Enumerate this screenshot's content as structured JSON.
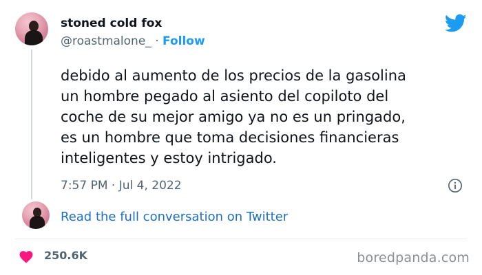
{
  "author": {
    "display_name": "stoned cold fox",
    "handle": "@roastmalone_",
    "separator": "·",
    "follow_label": "Follow"
  },
  "tweet": {
    "lines": [
      "debido al aumento de los precios de la gasolina",
      "un hombre pegado al asiento del copiloto del",
      "coche de su mejor amigo ya no es un pringado,",
      "es un hombre que toma decisiones financieras",
      "inteligentes y estoy intrigado."
    ],
    "timestamp": "7:57 PM · Jul 4, 2022"
  },
  "conversation_link": "Read the full conversation on Twitter",
  "engagement": {
    "like_count": "250.6K"
  },
  "watermark": "boredpanda.com",
  "icons": {
    "brand": "twitter-bird-icon",
    "info": "info-icon",
    "like": "heart-icon"
  },
  "colors": {
    "accent": "#1d9bf0",
    "heart": "#f91880",
    "secondary_text": "#536471"
  }
}
